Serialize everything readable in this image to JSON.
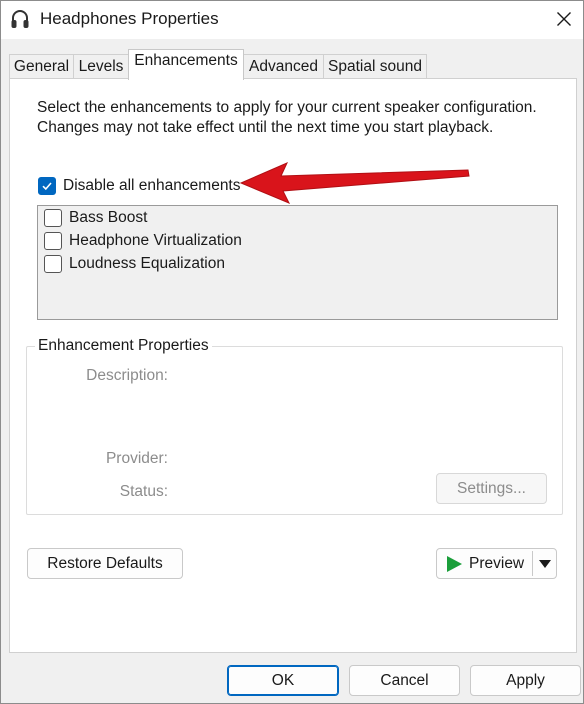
{
  "window": {
    "title": "Headphones Properties",
    "icon": "headphones-icon",
    "close_icon": "close-icon"
  },
  "tabs": [
    {
      "label": "General",
      "active": false
    },
    {
      "label": "Levels",
      "active": false
    },
    {
      "label": "Enhancements",
      "active": true
    },
    {
      "label": "Advanced",
      "active": false
    },
    {
      "label": "Spatial sound",
      "active": false
    }
  ],
  "enhancements": {
    "description": "Select the enhancements to apply for your current speaker configuration. Changes may not take effect until the next time you start playback.",
    "disable_all": {
      "label": "Disable all enhancements",
      "checked": true
    },
    "items": [
      {
        "label": "Bass Boost",
        "checked": false
      },
      {
        "label": "Headphone Virtualization",
        "checked": false
      },
      {
        "label": "Loudness Equalization",
        "checked": false
      }
    ]
  },
  "properties": {
    "title": "Enhancement Properties",
    "description_label": "Description:",
    "provider_label": "Provider:",
    "status_label": "Status:",
    "settings_button": "Settings..."
  },
  "actions": {
    "restore_defaults": "Restore Defaults",
    "preview": "Preview",
    "preview_icon": "play-icon",
    "dropdown_icon": "chevron-down-icon"
  },
  "footer": {
    "ok": "OK",
    "cancel": "Cancel",
    "apply": "Apply"
  },
  "colors": {
    "accent": "#0067c0",
    "annotation_arrow": "#d9141b",
    "play_green": "#1a9e3a"
  }
}
